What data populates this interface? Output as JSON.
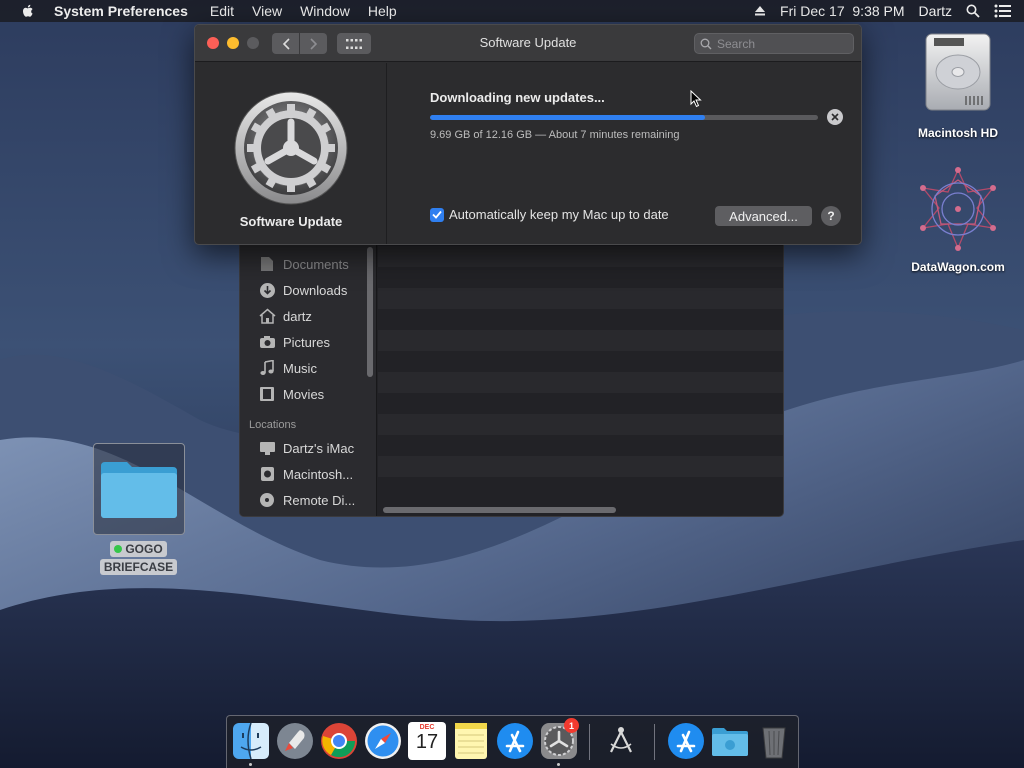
{
  "menubar": {
    "app_name": "System Preferences",
    "items": [
      "Edit",
      "View",
      "Window",
      "Help"
    ],
    "datetime": "Fri Dec 17  9:38 PM",
    "user": "Dartz"
  },
  "software_update": {
    "title": "Software Update",
    "search_placeholder": "Search",
    "pane_label": "Software Update",
    "status": "Downloading new updates...",
    "progress_fraction": 0.71,
    "detail": "9.69 GB of 12.16 GB — About 7 minutes remaining",
    "auto_update_label": "Automatically keep my Mac up to date",
    "auto_update_checked": true,
    "advanced_label": "Advanced...",
    "help_label": "?"
  },
  "finder": {
    "favorites": [
      {
        "label": "Documents",
        "icon": "document-icon"
      },
      {
        "label": "Downloads",
        "icon": "download-icon"
      },
      {
        "label": "dartz",
        "icon": "home-icon"
      },
      {
        "label": "Pictures",
        "icon": "camera-icon"
      },
      {
        "label": "Music",
        "icon": "music-icon"
      },
      {
        "label": "Movies",
        "icon": "film-icon"
      }
    ],
    "locations_heading": "Locations",
    "locations": [
      {
        "label": "Dartz's iMac",
        "icon": "imac-icon"
      },
      {
        "label": "Macintosh...",
        "icon": "disk-icon"
      },
      {
        "label": "Remote Di...",
        "icon": "optical-disc-icon"
      }
    ]
  },
  "desktop": {
    "macintosh_hd": "Macintosh HD",
    "datawagon": "DataWagon.com",
    "briefcase_line1": "GOGO",
    "briefcase_line2": "BRIEFCASE"
  },
  "dock": {
    "calendar_month": "DEC",
    "calendar_day": "17",
    "sysprefs_badge": "1",
    "items": [
      "finder-icon",
      "launchpad-icon",
      "chrome-icon",
      "safari-icon",
      "calendar-icon",
      "notes-icon",
      "app-store-icon",
      "system-preferences-icon",
      "utility-icon",
      "app-store-icon",
      "folder-icon",
      "trash-icon"
    ]
  },
  "colors": {
    "accent": "#2f7ff0",
    "close": "#fc5f57",
    "minimize": "#fdbc2e",
    "badge": "#f23a2f"
  }
}
